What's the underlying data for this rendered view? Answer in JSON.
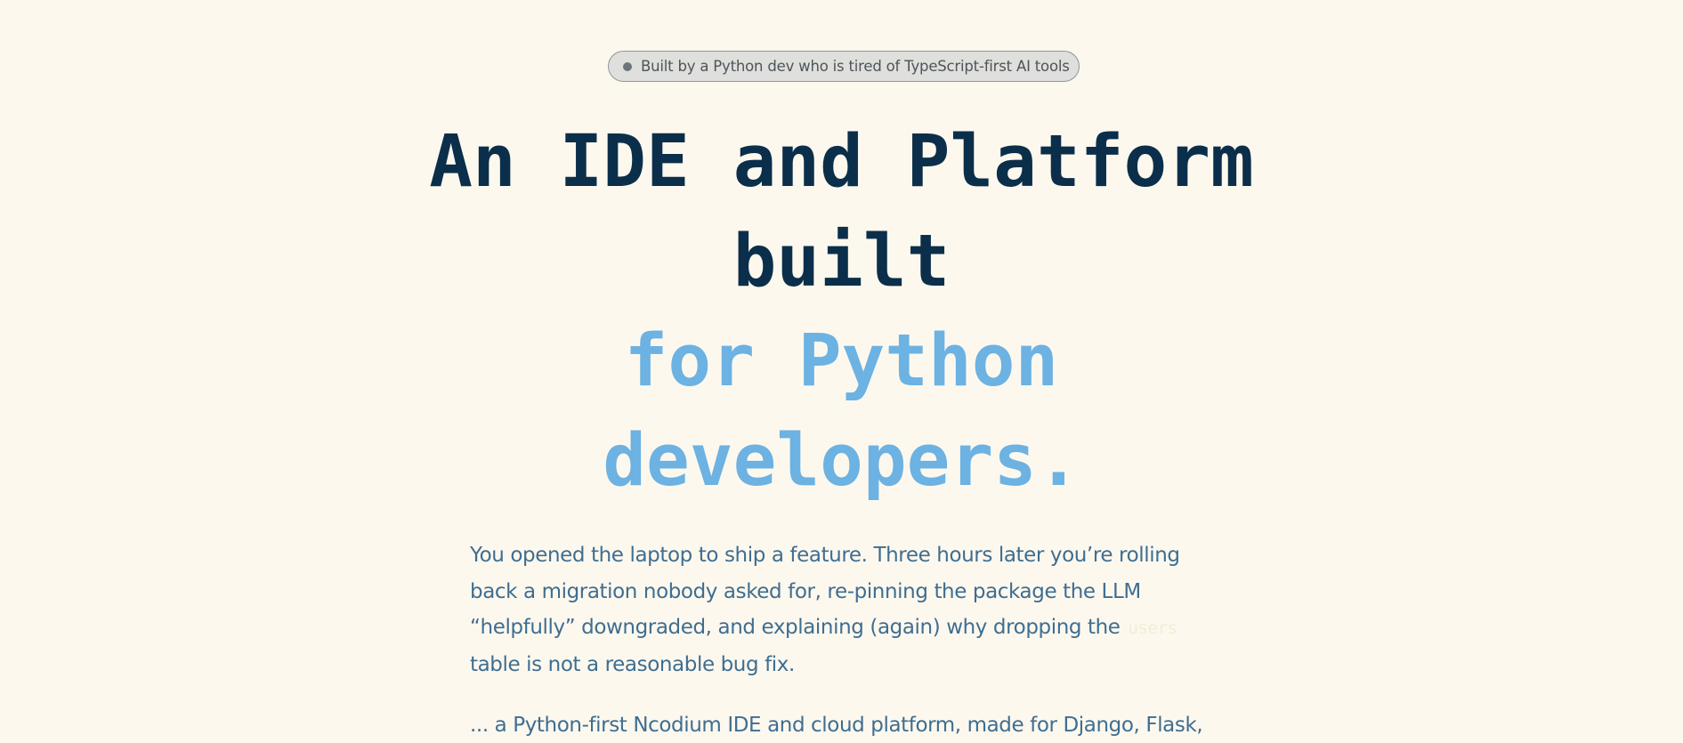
{
  "badge": {
    "text": "Built by a Python dev who is tired of TypeScript-first AI tools",
    "dot_icon": "status-dot-icon"
  },
  "hero": {
    "line1": "An IDE and Platform",
    "line2": "built",
    "line3": "for Python",
    "line4": "developers."
  },
  "intro": {
    "part1": "You opened the laptop to ship a feature. Three hours later you’re rolling back a migration nobody asked for, re-pinning the package the LLM “helpfully” downgraded, and explaining (again) why dropping the",
    "code": "users",
    "part2": "table is not a reasonable bug fix."
  },
  "next_paragraph": {
    "text": "... a Python-first Ncodium IDE and cloud platform, made for Django, Flask, FastAPI ..."
  },
  "colors": {
    "background": "#fdf8ee",
    "heading_dark": "#0b2f4a",
    "heading_accent": "#6cb2e2",
    "body_text": "#3e6e91",
    "badge_bg": "#dfe0dd"
  }
}
